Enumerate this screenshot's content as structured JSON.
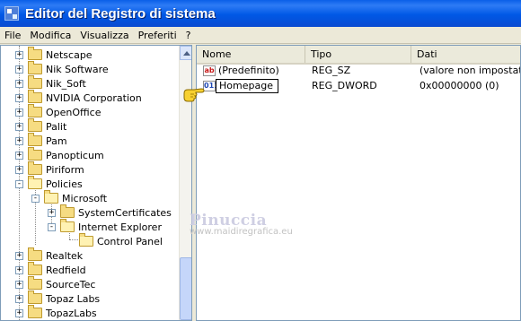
{
  "window": {
    "title": "Editor del Registro di sistema"
  },
  "menu": [
    "File",
    "Modifica",
    "Visualizza",
    "Preferiti",
    "?"
  ],
  "tree": {
    "items": [
      {
        "label": "Netscape",
        "expander": "+"
      },
      {
        "label": "Nik Software",
        "expander": "+"
      },
      {
        "label": "Nik_Soft",
        "expander": "+"
      },
      {
        "label": "NVIDIA Corporation",
        "expander": "+"
      },
      {
        "label": "OpenOffice",
        "expander": "+"
      },
      {
        "label": "Palit",
        "expander": "+"
      },
      {
        "label": "Pam",
        "expander": "+"
      },
      {
        "label": "Panopticum",
        "expander": "+"
      },
      {
        "label": "Piriform",
        "expander": "+"
      },
      {
        "label": "Policies",
        "expander": "-"
      },
      {
        "label": "Microsoft",
        "expander": "-"
      },
      {
        "label": "SystemCertificates",
        "expander": "+"
      },
      {
        "label": "Internet Explorer",
        "expander": "-"
      },
      {
        "label": "Control Panel",
        "expander": ""
      },
      {
        "label": "Realtek",
        "expander": "+"
      },
      {
        "label": "Redfield",
        "expander": "+"
      },
      {
        "label": "SourceTec",
        "expander": "+"
      },
      {
        "label": "Topaz Labs",
        "expander": "+"
      },
      {
        "label": "TopazLabs",
        "expander": "+"
      }
    ]
  },
  "list": {
    "columns": [
      "Nome",
      "Tipo",
      "Dati"
    ],
    "rows": [
      {
        "icon": "ab",
        "name": "(Predefinito)",
        "type": "REG_SZ",
        "data": "(valore non impostato)"
      },
      {
        "icon": "011",
        "name": "Homepage",
        "type": "REG_DWORD",
        "data": "0x00000000 (0)"
      }
    ]
  },
  "watermark": {
    "name": "Pinuccia",
    "site": "www.maidiregrafica.eu"
  }
}
